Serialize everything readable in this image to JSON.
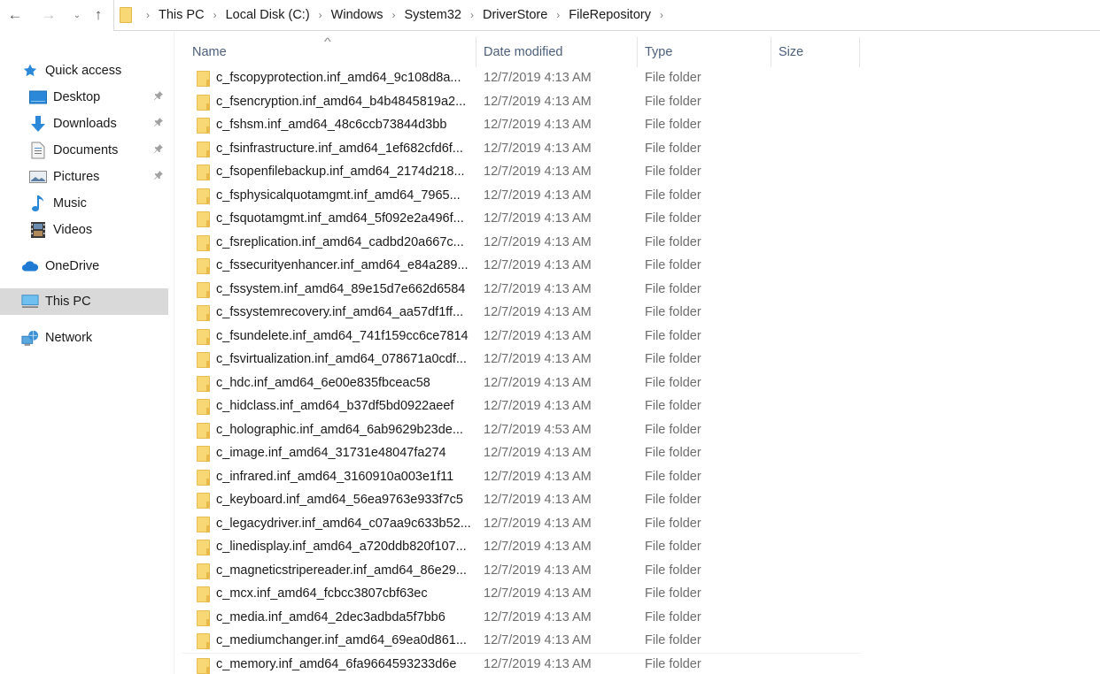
{
  "nav": {
    "back_icon": "arrow-left",
    "forward_icon": "arrow-right",
    "recent_icon": "chevron-down",
    "up_icon": "arrow-up"
  },
  "address": {
    "folder_icon": "folder-icon",
    "breadcrumbs": [
      "This PC",
      "Local Disk (C:)",
      "Windows",
      "System32",
      "DriverStore",
      "FileRepository"
    ],
    "separator": "›"
  },
  "sidebar": {
    "items": [
      {
        "label": "Quick access",
        "icon": "star-icon",
        "level": 0,
        "pinned": false,
        "selected": false
      },
      {
        "label": "Desktop",
        "icon": "desktop-icon",
        "level": 1,
        "pinned": true,
        "selected": false
      },
      {
        "label": "Downloads",
        "icon": "download-icon",
        "level": 1,
        "pinned": true,
        "selected": false
      },
      {
        "label": "Documents",
        "icon": "document-icon",
        "level": 1,
        "pinned": true,
        "selected": false
      },
      {
        "label": "Pictures",
        "icon": "picture-icon",
        "level": 1,
        "pinned": true,
        "selected": false
      },
      {
        "label": "Music",
        "icon": "music-icon",
        "level": 1,
        "pinned": false,
        "selected": false
      },
      {
        "label": "Videos",
        "icon": "video-icon",
        "level": 1,
        "pinned": false,
        "selected": false
      },
      {
        "label": "OneDrive",
        "icon": "cloud-icon",
        "level": 0,
        "pinned": false,
        "selected": false
      },
      {
        "label": "This PC",
        "icon": "computer-icon",
        "level": 0,
        "pinned": false,
        "selected": true
      },
      {
        "label": "Network",
        "icon": "network-icon",
        "level": 0,
        "pinned": false,
        "selected": false
      }
    ],
    "pin_glyph": "📌"
  },
  "columns": {
    "name": "Name",
    "date": "Date modified",
    "type": "Type",
    "size": "Size",
    "sort_indicator": "^"
  },
  "files": [
    {
      "name": "c_fscopyprotection.inf_amd64_9c108d8a...",
      "date": "12/7/2019 4:13 AM",
      "type": "File folder",
      "size": ""
    },
    {
      "name": "c_fsencryption.inf_amd64_b4b4845819a2...",
      "date": "12/7/2019 4:13 AM",
      "type": "File folder",
      "size": ""
    },
    {
      "name": "c_fshsm.inf_amd64_48c6ccb73844d3bb",
      "date": "12/7/2019 4:13 AM",
      "type": "File folder",
      "size": ""
    },
    {
      "name": "c_fsinfrastructure.inf_amd64_1ef682cfd6f...",
      "date": "12/7/2019 4:13 AM",
      "type": "File folder",
      "size": ""
    },
    {
      "name": "c_fsopenfilebackup.inf_amd64_2174d218...",
      "date": "12/7/2019 4:13 AM",
      "type": "File folder",
      "size": ""
    },
    {
      "name": "c_fsphysicalquotamgmt.inf_amd64_7965...",
      "date": "12/7/2019 4:13 AM",
      "type": "File folder",
      "size": ""
    },
    {
      "name": "c_fsquotamgmt.inf_amd64_5f092e2a496f...",
      "date": "12/7/2019 4:13 AM",
      "type": "File folder",
      "size": ""
    },
    {
      "name": "c_fsreplication.inf_amd64_cadbd20a667c...",
      "date": "12/7/2019 4:13 AM",
      "type": "File folder",
      "size": ""
    },
    {
      "name": "c_fssecurityenhancer.inf_amd64_e84a289...",
      "date": "12/7/2019 4:13 AM",
      "type": "File folder",
      "size": ""
    },
    {
      "name": "c_fssystem.inf_amd64_89e15d7e662d6584",
      "date": "12/7/2019 4:13 AM",
      "type": "File folder",
      "size": ""
    },
    {
      "name": "c_fssystemrecovery.inf_amd64_aa57df1ff...",
      "date": "12/7/2019 4:13 AM",
      "type": "File folder",
      "size": ""
    },
    {
      "name": "c_fsundelete.inf_amd64_741f159cc6ce7814",
      "date": "12/7/2019 4:13 AM",
      "type": "File folder",
      "size": ""
    },
    {
      "name": "c_fsvirtualization.inf_amd64_078671a0cdf...",
      "date": "12/7/2019 4:13 AM",
      "type": "File folder",
      "size": ""
    },
    {
      "name": "c_hdc.inf_amd64_6e00e835fbceac58",
      "date": "12/7/2019 4:13 AM",
      "type": "File folder",
      "size": ""
    },
    {
      "name": "c_hidclass.inf_amd64_b37df5bd0922aeef",
      "date": "12/7/2019 4:13 AM",
      "type": "File folder",
      "size": ""
    },
    {
      "name": "c_holographic.inf_amd64_6ab9629b23de...",
      "date": "12/7/2019 4:53 AM",
      "type": "File folder",
      "size": ""
    },
    {
      "name": "c_image.inf_amd64_31731e48047fa274",
      "date": "12/7/2019 4:13 AM",
      "type": "File folder",
      "size": ""
    },
    {
      "name": "c_infrared.inf_amd64_3160910a003e1f11",
      "date": "12/7/2019 4:13 AM",
      "type": "File folder",
      "size": ""
    },
    {
      "name": "c_keyboard.inf_amd64_56ea9763e933f7c5",
      "date": "12/7/2019 4:13 AM",
      "type": "File folder",
      "size": ""
    },
    {
      "name": "c_legacydriver.inf_amd64_c07aa9c633b52...",
      "date": "12/7/2019 4:13 AM",
      "type": "File folder",
      "size": ""
    },
    {
      "name": "c_linedisplay.inf_amd64_a720ddb820f107...",
      "date": "12/7/2019 4:13 AM",
      "type": "File folder",
      "size": ""
    },
    {
      "name": "c_magneticstripereader.inf_amd64_86e29...",
      "date": "12/7/2019 4:13 AM",
      "type": "File folder",
      "size": ""
    },
    {
      "name": "c_mcx.inf_amd64_fcbcc3807cbf63ec",
      "date": "12/7/2019 4:13 AM",
      "type": "File folder",
      "size": ""
    },
    {
      "name": "c_media.inf_amd64_2dec3adbda5f7bb6",
      "date": "12/7/2019 4:13 AM",
      "type": "File folder",
      "size": ""
    },
    {
      "name": "c_mediumchanger.inf_amd64_69ea0d861...",
      "date": "12/7/2019 4:13 AM",
      "type": "File folder",
      "size": ""
    },
    {
      "name": "c_memory.inf_amd64_6fa9664593233d6e",
      "date": "12/7/2019 4:13 AM",
      "type": "File folder",
      "size": ""
    }
  ],
  "colors": {
    "folder": "#f8d775",
    "selected_nav_bg": "#d9d9d9",
    "header_text": "#4c607a",
    "secondary_text": "#6d6d6d",
    "accent_blue": "#2b88d8"
  }
}
